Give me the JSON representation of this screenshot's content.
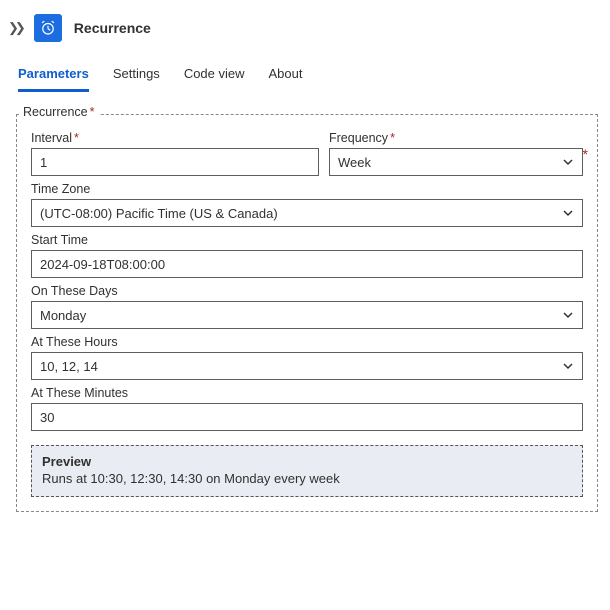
{
  "header": {
    "title": "Recurrence",
    "icon": "alarm-clock-icon"
  },
  "tabs": {
    "parameters": "Parameters",
    "settings": "Settings",
    "codeview": "Code view",
    "about": "About",
    "active": "parameters"
  },
  "group": {
    "legend": "Recurrence"
  },
  "fields": {
    "interval": {
      "label": "Interval",
      "value": "1",
      "required": true
    },
    "frequency": {
      "label": "Frequency",
      "value": "Week",
      "required": true
    },
    "timezone": {
      "label": "Time Zone",
      "value": "(UTC-08:00) Pacific Time (US & Canada)"
    },
    "starttime": {
      "label": "Start Time",
      "value": "2024-09-18T08:00:00"
    },
    "days": {
      "label": "On These Days",
      "value": "Monday"
    },
    "hours": {
      "label": "At These Hours",
      "value": "10, 12, 14"
    },
    "minutes": {
      "label": "At These Minutes",
      "value": "30"
    }
  },
  "preview": {
    "title": "Preview",
    "body": "Runs at 10:30, 12:30, 14:30 on Monday every week"
  }
}
